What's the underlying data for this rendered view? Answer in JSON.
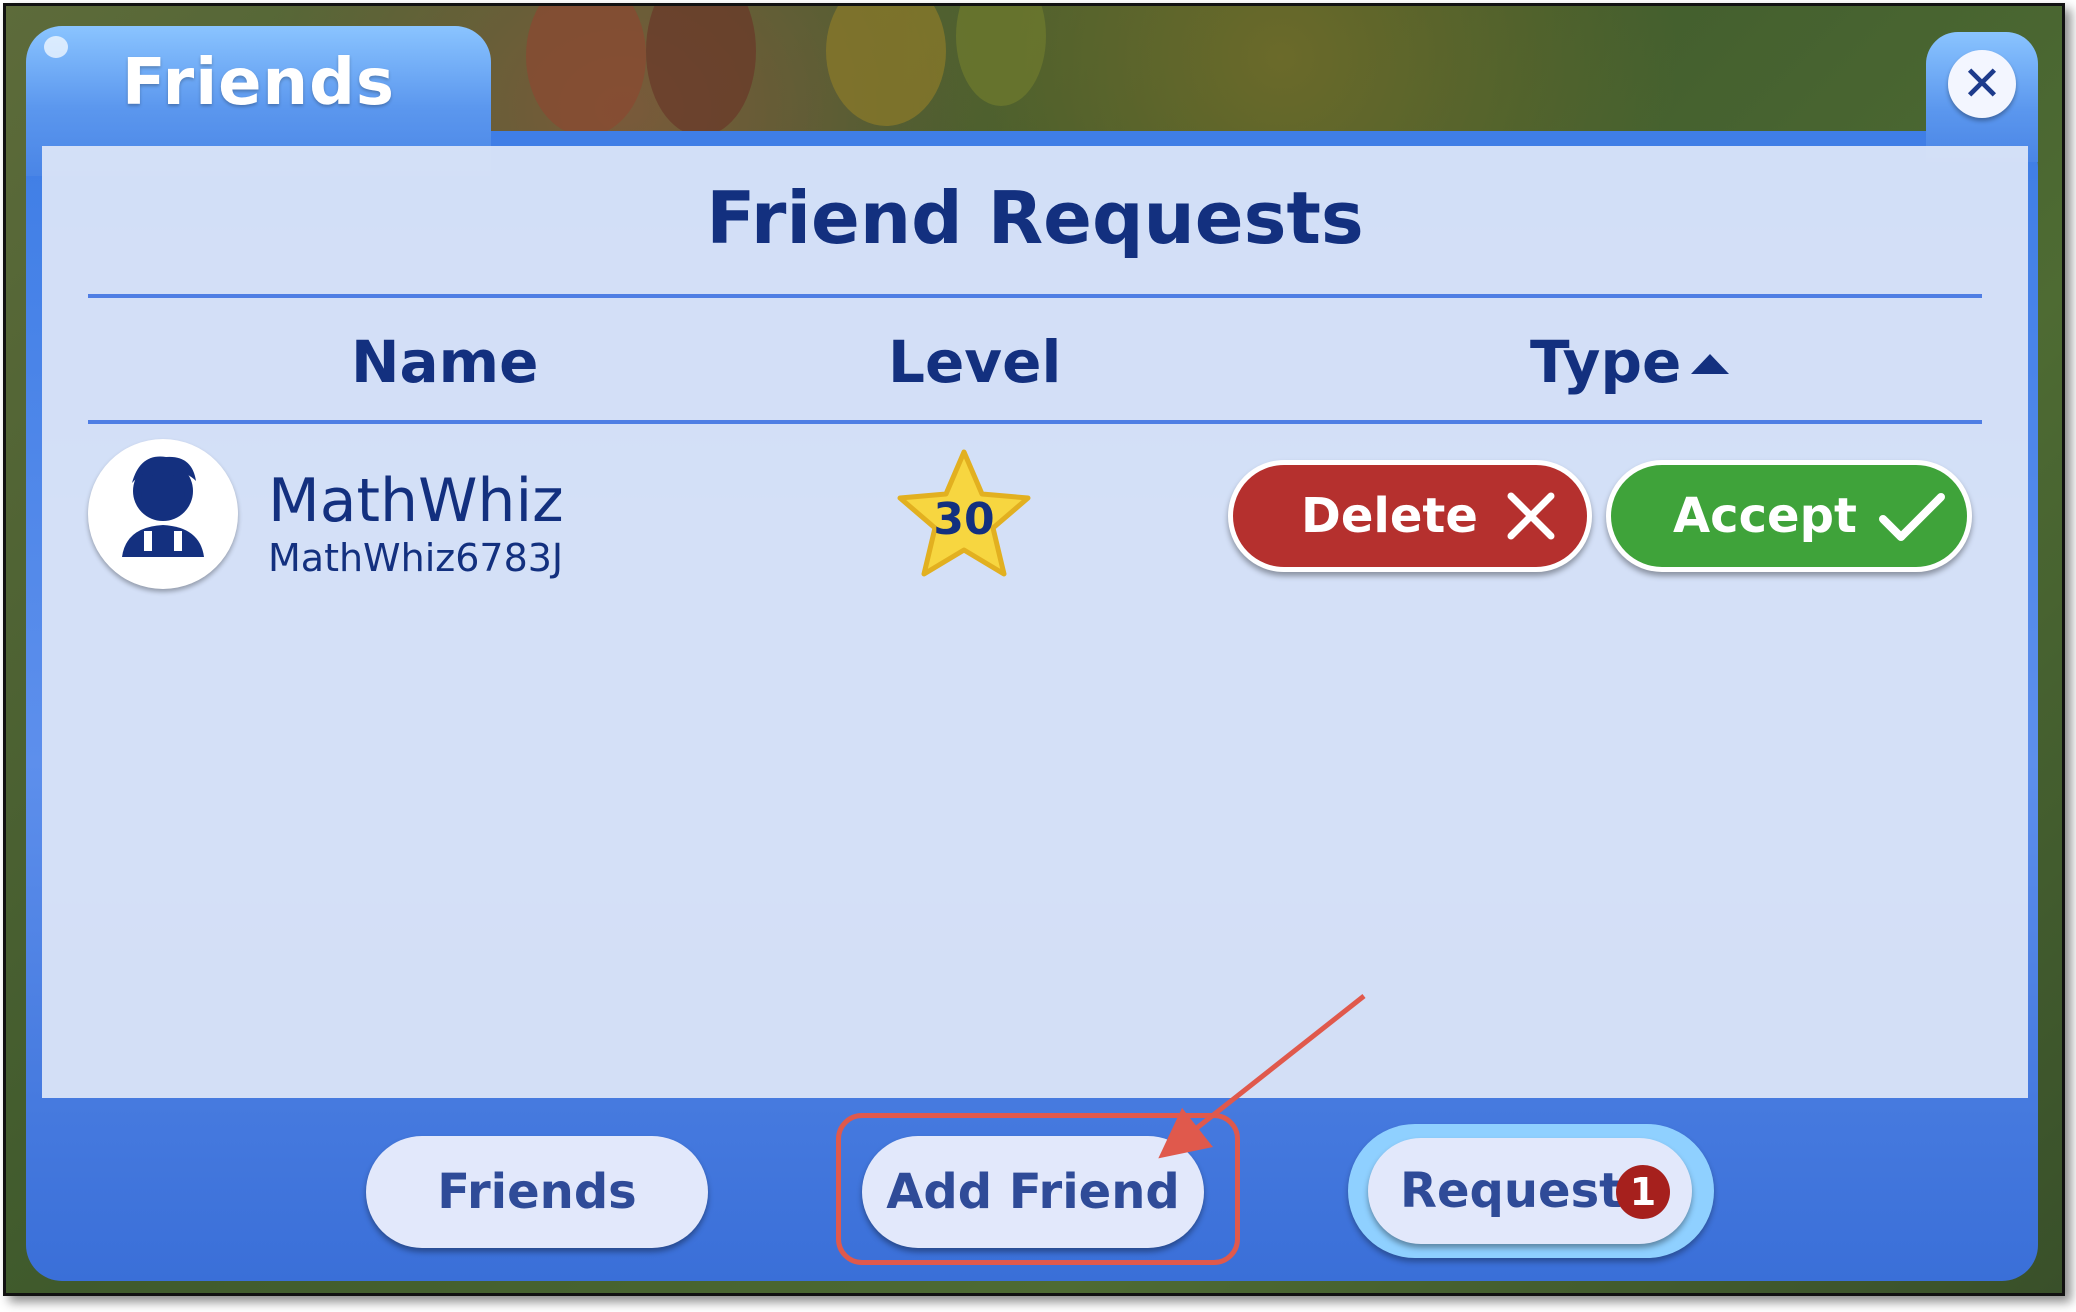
{
  "window": {
    "tab_title": "Friends",
    "close_label": "✕"
  },
  "panel": {
    "title": "Friend Requests",
    "columns": {
      "name": "Name",
      "level": "Level",
      "type": "Type"
    },
    "type_sort": "ascending",
    "rows": [
      {
        "display_name": "MathWhiz",
        "username": "MathWhiz6783J",
        "level": "30",
        "delete_label": "Delete",
        "accept_label": "Accept"
      }
    ]
  },
  "bottom_nav": {
    "friends_label": "Friends",
    "add_friend_label": "Add Friend",
    "requests_label": "Requests",
    "requests_badge": "1"
  },
  "colors": {
    "title_navy": "#13307f",
    "window_blue": "#4a85e6",
    "delete_red": "#b5302e",
    "accept_green": "#3fa33a",
    "highlight_annotation": "#e0594c",
    "star_yellow": "#f7d640"
  }
}
